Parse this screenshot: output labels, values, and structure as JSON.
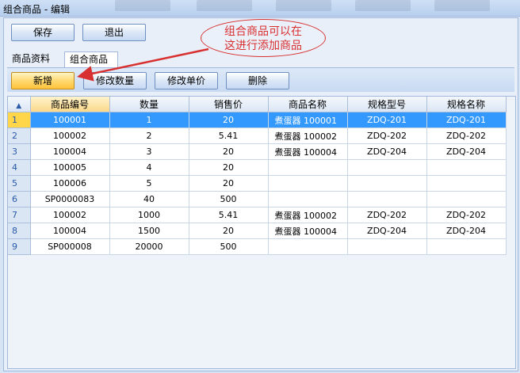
{
  "window": {
    "title": "组合商品 - 编辑"
  },
  "toolbar": {
    "save_label": "保存",
    "exit_label": "退出"
  },
  "tabs": [
    {
      "label": "商品资料"
    },
    {
      "label": "组合商品"
    }
  ],
  "actions": {
    "add_label": "新增",
    "edit_qty_label": "修改数量",
    "edit_price_label": "修改单价",
    "delete_label": "删除"
  },
  "callout": {
    "line1": "组合商品可以在",
    "line2": "这进行添加商品"
  },
  "colors": {
    "accent": "#3399ff",
    "highlight": "#ffc23a",
    "annotation": "#d83030"
  },
  "grid": {
    "corner_icon": "sort-icon",
    "columns": [
      "商品编号",
      "数量",
      "销售价",
      "商品名称",
      "规格型号",
      "规格名称"
    ],
    "rows": [
      {
        "num": "1",
        "code": "100001",
        "qty": "1",
        "price": "20",
        "name": "煮蛋器 100001",
        "model": "ZDQ-201",
        "spec": "ZDQ-201"
      },
      {
        "num": "2",
        "code": "100002",
        "qty": "2",
        "price": "5.41",
        "name": "煮蛋器 100002",
        "model": "ZDQ-202",
        "spec": "ZDQ-202"
      },
      {
        "num": "3",
        "code": "100004",
        "qty": "3",
        "price": "20",
        "name": "煮蛋器 100004",
        "model": "ZDQ-204",
        "spec": "ZDQ-204"
      },
      {
        "num": "4",
        "code": "100005",
        "qty": "4",
        "price": "20",
        "name": "",
        "model": "",
        "spec": ""
      },
      {
        "num": "5",
        "code": "100006",
        "qty": "5",
        "price": "20",
        "name": "",
        "model": "",
        "spec": ""
      },
      {
        "num": "6",
        "code": "SP0000083",
        "qty": "40",
        "price": "500",
        "name": "",
        "model": "",
        "spec": ""
      },
      {
        "num": "7",
        "code": "100002",
        "qty": "1000",
        "price": "5.41",
        "name": "煮蛋器 100002",
        "model": "ZDQ-202",
        "spec": "ZDQ-202"
      },
      {
        "num": "8",
        "code": "100004",
        "qty": "1500",
        "price": "20",
        "name": "煮蛋器 100004",
        "model": "ZDQ-204",
        "spec": "ZDQ-204"
      },
      {
        "num": "9",
        "code": "SP000008",
        "qty": "20000",
        "price": "500",
        "name": "",
        "model": "",
        "spec": ""
      }
    ]
  }
}
